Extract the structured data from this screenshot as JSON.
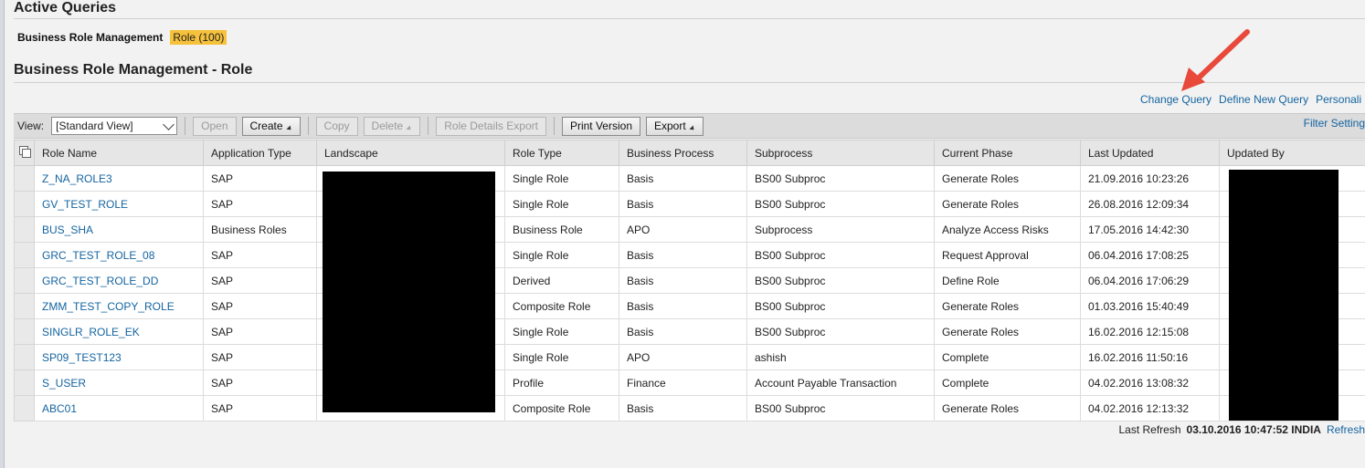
{
  "active_queries_title": "Active Queries",
  "saved_query": {
    "label": "Business Role Management",
    "chip": "Role (100)"
  },
  "page_title": "Business Role Management - Role",
  "links": {
    "change_query": "Change Query",
    "define_new_query": "Define New Query",
    "personalize": "Personali"
  },
  "toolbar": {
    "view_label": "View:",
    "view_value": "[Standard View]",
    "open": "Open",
    "create": "Create",
    "copy": "Copy",
    "delete": "Delete",
    "role_details_export": "Role Details Export",
    "print_version": "Print Version",
    "export": "Export",
    "filter_settings": "Filter Setting"
  },
  "columns": [
    "Role Name",
    "Application Type",
    "Landscape",
    "Role Type",
    "Business Process",
    "Subprocess",
    "Current Phase",
    "Last Updated",
    "Updated By"
  ],
  "rows": [
    {
      "role": "Z_NA_ROLE3",
      "app": "SAP",
      "landscape": "",
      "type": "Single Role",
      "process": "Basis",
      "sub": "BS00 Subproc",
      "phase": "Generate Roles",
      "updated": "21.09.2016 10:23:26",
      "by": ""
    },
    {
      "role": "GV_TEST_ROLE",
      "app": "SAP",
      "landscape": "",
      "type": "Single Role",
      "process": "Basis",
      "sub": "BS00 Subproc",
      "phase": "Generate Roles",
      "updated": "26.08.2016 12:09:34",
      "by": ""
    },
    {
      "role": "BUS_SHA",
      "app": "Business Roles",
      "landscape": "",
      "type": "Business Role",
      "process": "APO",
      "sub": "Subprocess",
      "phase": "Analyze Access Risks",
      "updated": "17.05.2016 14:42:30",
      "by": ""
    },
    {
      "role": "GRC_TEST_ROLE_08",
      "app": "SAP",
      "landscape": "",
      "type": "Single Role",
      "process": "Basis",
      "sub": "BS00 Subproc",
      "phase": "Request Approval",
      "updated": "06.04.2016 17:08:25",
      "by": ""
    },
    {
      "role": "GRC_TEST_ROLE_DD",
      "app": "SAP",
      "landscape": "",
      "type": "Derived",
      "process": "Basis",
      "sub": "BS00 Subproc",
      "phase": "Define Role",
      "updated": "06.04.2016 17:06:29",
      "by": ""
    },
    {
      "role": "ZMM_TEST_COPY_ROLE",
      "app": "SAP",
      "landscape": "",
      "type": "Composite Role",
      "process": "Basis",
      "sub": "BS00 Subproc",
      "phase": "Generate Roles",
      "updated": "01.03.2016 15:40:49",
      "by": ""
    },
    {
      "role": "SINGLR_ROLE_EK",
      "app": "SAP",
      "landscape": "",
      "type": "Single Role",
      "process": "Basis",
      "sub": "BS00 Subproc",
      "phase": "Generate Roles",
      "updated": "16.02.2016 12:15:08",
      "by": ""
    },
    {
      "role": "SP09_TEST123",
      "app": "SAP",
      "landscape": "",
      "type": "Single Role",
      "process": "APO",
      "sub": "ashish",
      "phase": "Complete",
      "updated": "16.02.2016 11:50:16",
      "by": ""
    },
    {
      "role": "S_USER",
      "app": "SAP",
      "landscape": "",
      "type": "Profile",
      "process": "Finance",
      "sub": "Account Payable Transaction",
      "phase": "Complete",
      "updated": "04.02.2016 13:08:32",
      "by": ""
    },
    {
      "role": "ABC01",
      "app": "SAP",
      "landscape": "",
      "type": "Composite Role",
      "process": "Basis",
      "sub": "BS00 Subproc",
      "phase": "Generate Roles",
      "updated": "04.02.2016 12:13:32",
      "by": ""
    }
  ],
  "footer": {
    "label": "Last Refresh",
    "timestamp": "03.10.2016 10:47:52 INDIA",
    "refresh": "Refresh"
  },
  "colors": {
    "link": "#1464a0",
    "chip": "#f6c13b",
    "arrow": "#e8493a"
  }
}
